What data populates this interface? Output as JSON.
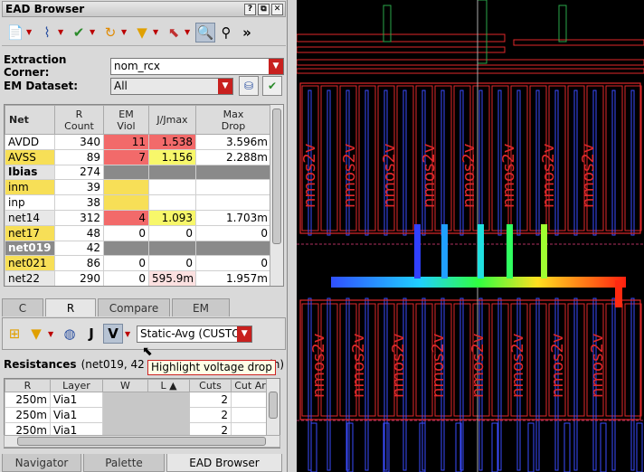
{
  "window": {
    "title": "EAD Browser",
    "buttons": [
      "?",
      "⧉",
      "✕"
    ]
  },
  "toolbar": {
    "tools": [
      {
        "icon": "document-icon",
        "glyph": "📄"
      },
      {
        "icon": "resistor-probe-icon",
        "glyph": "⌇"
      },
      {
        "icon": "check-flag-icon",
        "glyph": "✔"
      },
      {
        "icon": "undo-icon",
        "glyph": "↻"
      },
      {
        "icon": "filter-icon",
        "glyph": "▼"
      },
      {
        "icon": "probe-cursor-icon",
        "glyph": "⬉"
      },
      {
        "icon": "zoom-icon",
        "glyph": "🔍"
      },
      {
        "icon": "binoculars-icon",
        "glyph": "⚲"
      }
    ],
    "overflow": "»"
  },
  "extraction": {
    "label": "Extraction Corner:",
    "value": "nom_rcx"
  },
  "dataset": {
    "label": "EM Dataset:",
    "value": "All"
  },
  "net_table": {
    "headers": [
      "Net",
      "R\nCount",
      "EM\nViol",
      "J/Jmax",
      "Max\nDrop"
    ],
    "rows": [
      {
        "net": "AVDD",
        "r": "340",
        "em": "11",
        "j": "1.538",
        "drop": "3.596m",
        "netc": "#ffffff",
        "emc": "#f26a6a",
        "jc": "#f26a6a",
        "dc": "#ffffff",
        "bold": false
      },
      {
        "net": "AVSS",
        "r": "89",
        "em": "7",
        "j": "1.156",
        "drop": "2.288m",
        "netc": "#f7df57",
        "emc": "#f26a6a",
        "jc": "#f7f76a",
        "dc": "#ffffff",
        "bold": false
      },
      {
        "net": "Ibias",
        "r": "274",
        "em": "",
        "j": "",
        "drop": "",
        "netc": "#e3e3e3",
        "emc": "#8a8a8a",
        "jc": "#8a8a8a",
        "dc": "#8a8a8a",
        "bold": true
      },
      {
        "net": "inm",
        "r": "39",
        "em": "",
        "j": "",
        "drop": "",
        "netc": "#f7df57",
        "emc": "#f7df57",
        "jc": "#ffffff",
        "dc": "#ffffff",
        "bold": false
      },
      {
        "net": "inp",
        "r": "38",
        "em": "",
        "j": "",
        "drop": "",
        "netc": "#ffffff",
        "emc": "#f7df57",
        "jc": "#ffffff",
        "dc": "#ffffff",
        "bold": false
      },
      {
        "net": "net14",
        "r": "312",
        "em": "4",
        "j": "1.093",
        "drop": "1.703m",
        "netc": "#e8e8e8",
        "emc": "#f26a6a",
        "jc": "#f7f76a",
        "dc": "#ffffff",
        "bold": false
      },
      {
        "net": "net17",
        "r": "48",
        "em": "0",
        "j": "0",
        "drop": "0",
        "netc": "#f7df57",
        "emc": "#ffffff",
        "jc": "#ffffff",
        "dc": "#ffffff",
        "bold": false
      },
      {
        "net": "net019",
        "r": "42",
        "em": "",
        "j": "",
        "drop": "",
        "netc": "#8a8a8a",
        "emc": "#8a8a8a",
        "jc": "#8a8a8a",
        "dc": "#8a8a8a",
        "bold": true,
        "white": true
      },
      {
        "net": "net021",
        "r": "86",
        "em": "0",
        "j": "0",
        "drop": "0",
        "netc": "#f7df57",
        "emc": "#ffffff",
        "jc": "#ffffff",
        "dc": "#ffffff",
        "bold": false
      },
      {
        "net": "net22",
        "r": "290",
        "em": "0",
        "j": "595.9m",
        "drop": "1.957m",
        "netc": "#e8e8e8",
        "emc": "#ffffff",
        "jc": "#fbe0e0",
        "dc": "#ffffff",
        "bold": false
      }
    ]
  },
  "tabs": [
    {
      "label": "C",
      "active": false
    },
    {
      "label": "R",
      "active": true
    },
    {
      "label": "Compare",
      "active": false
    },
    {
      "label": "EM",
      "active": false
    }
  ],
  "sub_toolbar": {
    "tools": [
      "probe-icon",
      "filter-icon",
      "net-icon",
      "current-icon",
      "voltage-drop-icon"
    ],
    "glyphs": [
      "⊞",
      "▼",
      "◍",
      "J",
      "V"
    ],
    "mode": "Static-Avg (CUSTO"
  },
  "resistances": {
    "label": "Resistances",
    "detail": "(net019, 42 va",
    "tail": "min)"
  },
  "tooltip": "Highlight voltage drop",
  "res_table": {
    "headers": [
      "R",
      "Layer",
      "W",
      "L",
      "Cuts",
      "Cut Ar"
    ],
    "rows": [
      {
        "r": "250m",
        "layer": "Via1",
        "w": "",
        "l": "",
        "cuts": "2"
      },
      {
        "r": "250m",
        "layer": "Via1",
        "w": "",
        "l": "",
        "cuts": "2"
      },
      {
        "r": "250m",
        "layer": "Via1",
        "w": "",
        "l": "",
        "cuts": "2"
      }
    ]
  },
  "bottom_tabs": [
    {
      "label": "Navigator",
      "active": false
    },
    {
      "label": "Palette",
      "active": false
    },
    {
      "label": "EAD Browser",
      "active": true
    }
  ],
  "layout": {
    "device_label": "nmos2v"
  }
}
